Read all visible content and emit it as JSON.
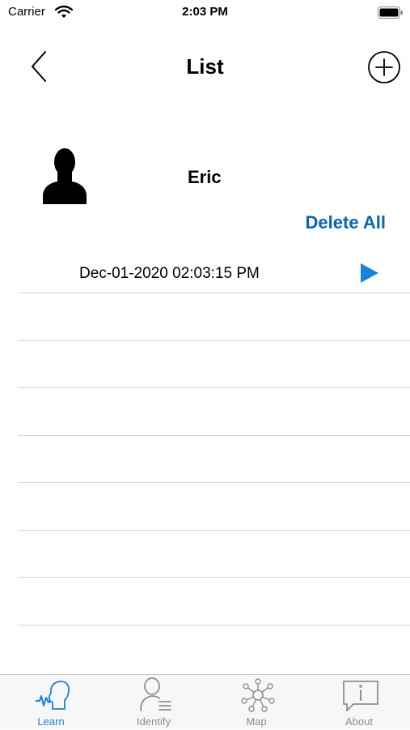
{
  "status_bar": {
    "carrier": "Carrier",
    "time": "2:03 PM"
  },
  "nav": {
    "title": "List"
  },
  "person": {
    "name": "Eric"
  },
  "actions": {
    "delete_all": "Delete All"
  },
  "recordings": [
    {
      "date": "Dec-01-2020 02:03:15 PM"
    }
  ],
  "tabs": [
    {
      "label": "Learn",
      "icon": "learn-icon",
      "active": true
    },
    {
      "label": "Identify",
      "icon": "identify-icon",
      "active": false
    },
    {
      "label": "Map",
      "icon": "map-icon",
      "active": false
    },
    {
      "label": "About",
      "icon": "about-icon",
      "active": false
    }
  ],
  "colors": {
    "accent": "#1a82d6",
    "link": "#0a64b4",
    "inactive": "#8e8e93"
  }
}
